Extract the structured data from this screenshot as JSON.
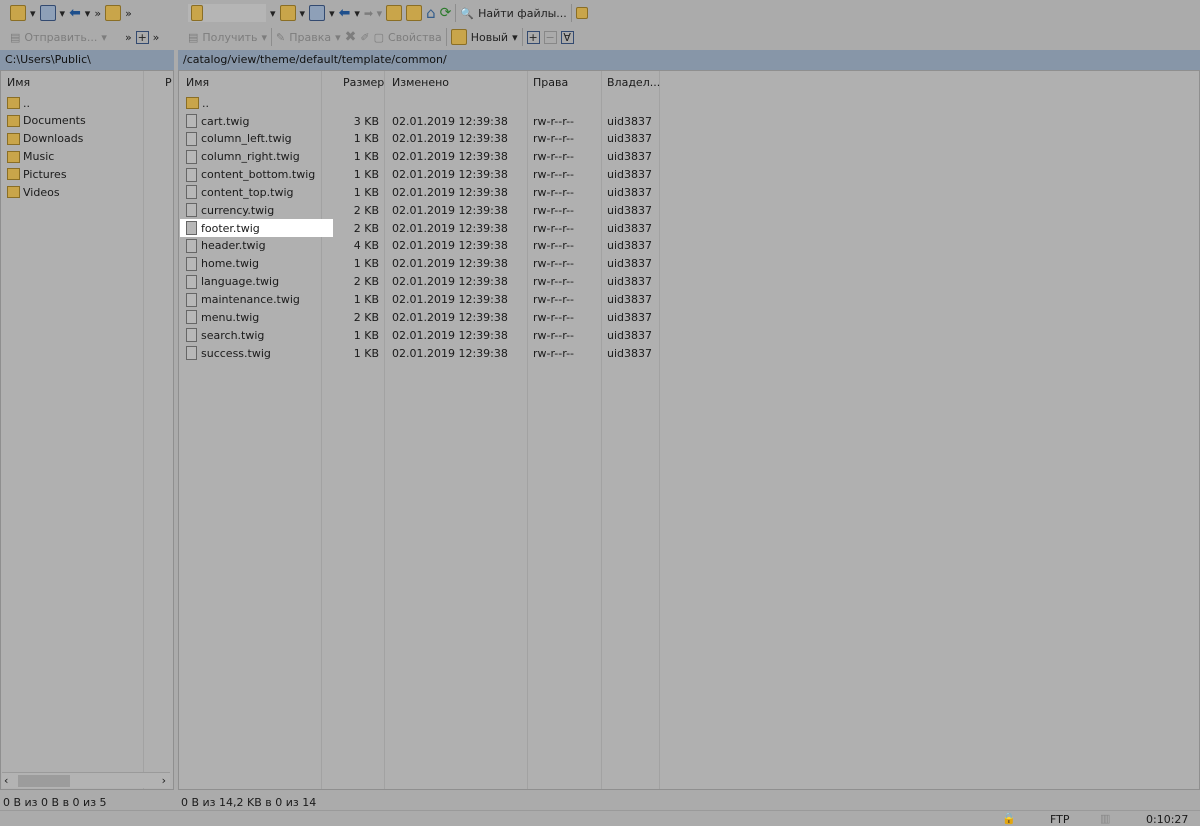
{
  "toolbar": {
    "find_files": "Найти файлы...",
    "upload": "Отправить...",
    "download": "Получить",
    "edit": "Правка",
    "properties": "Свойства",
    "new": "Новый",
    "more": "»"
  },
  "local": {
    "path": "C:\\Users\\Public\\",
    "col_name": "Имя",
    "col_r": "Р",
    "items": [
      "..",
      "Documents",
      "Downloads",
      "Music",
      "Pictures",
      "Videos"
    ],
    "status": "0 B из 0 B в 0 из 5"
  },
  "remote": {
    "path": "/catalog/view/theme/default/template/common/",
    "columns": {
      "name": "Имя",
      "size": "Размер",
      "modified": "Изменено",
      "rights": "Права",
      "owner": "Владел..."
    },
    "parent": "..",
    "files": [
      {
        "name": "cart.twig",
        "size": "3 KB",
        "modified": "02.01.2019 12:39:38",
        "rights": "rw-r--r--",
        "owner": "uid3837"
      },
      {
        "name": "column_left.twig",
        "size": "1 KB",
        "modified": "02.01.2019 12:39:38",
        "rights": "rw-r--r--",
        "owner": "uid3837"
      },
      {
        "name": "column_right.twig",
        "size": "1 KB",
        "modified": "02.01.2019 12:39:38",
        "rights": "rw-r--r--",
        "owner": "uid3837"
      },
      {
        "name": "content_bottom.twig",
        "size": "1 KB",
        "modified": "02.01.2019 12:39:38",
        "rights": "rw-r--r--",
        "owner": "uid3837"
      },
      {
        "name": "content_top.twig",
        "size": "1 KB",
        "modified": "02.01.2019 12:39:38",
        "rights": "rw-r--r--",
        "owner": "uid3837"
      },
      {
        "name": "currency.twig",
        "size": "2 KB",
        "modified": "02.01.2019 12:39:38",
        "rights": "rw-r--r--",
        "owner": "uid3837"
      },
      {
        "name": "footer.twig",
        "size": "2 KB",
        "modified": "02.01.2019 12:39:38",
        "rights": "rw-r--r--",
        "owner": "uid3837"
      },
      {
        "name": "header.twig",
        "size": "4 KB",
        "modified": "02.01.2019 12:39:38",
        "rights": "rw-r--r--",
        "owner": "uid3837"
      },
      {
        "name": "home.twig",
        "size": "1 KB",
        "modified": "02.01.2019 12:39:38",
        "rights": "rw-r--r--",
        "owner": "uid3837"
      },
      {
        "name": "language.twig",
        "size": "2 KB",
        "modified": "02.01.2019 12:39:38",
        "rights": "rw-r--r--",
        "owner": "uid3837"
      },
      {
        "name": "maintenance.twig",
        "size": "1 KB",
        "modified": "02.01.2019 12:39:38",
        "rights": "rw-r--r--",
        "owner": "uid3837"
      },
      {
        "name": "menu.twig",
        "size": "2 KB",
        "modified": "02.01.2019 12:39:38",
        "rights": "rw-r--r--",
        "owner": "uid3837"
      },
      {
        "name": "search.twig",
        "size": "1 KB",
        "modified": "02.01.2019 12:39:38",
        "rights": "rw-r--r--",
        "owner": "uid3837"
      },
      {
        "name": "success.twig",
        "size": "1 KB",
        "modified": "02.01.2019 12:39:38",
        "rights": "rw-r--r--",
        "owner": "uid3837"
      }
    ],
    "highlighted": "footer.twig",
    "status": "0 B из 14,2 KB в 0 из 14"
  },
  "statusbar": {
    "protocol": "FTP",
    "time": "0:10:27"
  }
}
